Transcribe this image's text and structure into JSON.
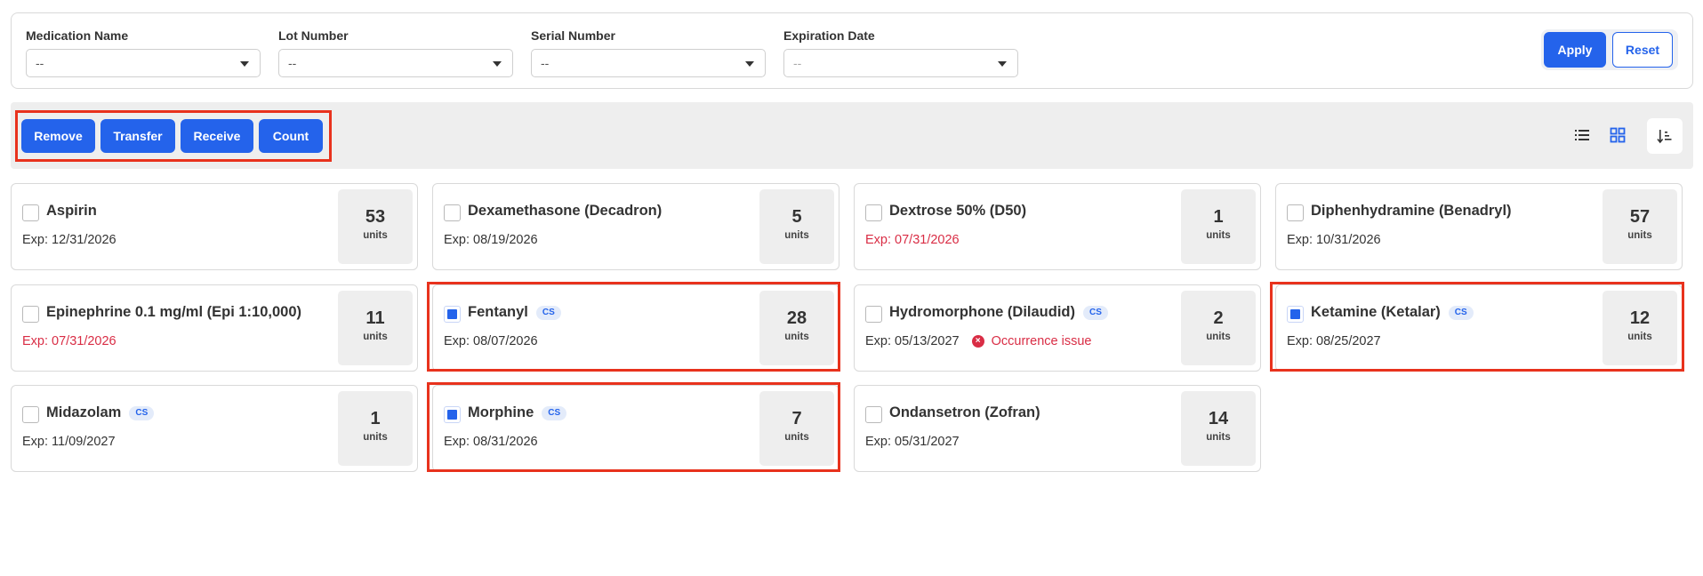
{
  "filters": [
    {
      "label": "Medication Name",
      "value": "--",
      "muted": false
    },
    {
      "label": "Lot Number",
      "value": "--",
      "muted": false
    },
    {
      "label": "Serial Number",
      "value": "--",
      "muted": false
    },
    {
      "label": "Expiration Date",
      "value": "--",
      "muted": true
    }
  ],
  "filter_actions": {
    "apply_label": "Apply",
    "reset_label": "Reset"
  },
  "actions": {
    "remove": "Remove",
    "transfer": "Transfer",
    "receive": "Receive",
    "count": "Count"
  },
  "view_controls": {
    "list_icon": "list-view-icon",
    "grid_icon": "grid-view-icon",
    "sort_icon": "sort-icon",
    "active_view": "grid"
  },
  "colors": {
    "primary": "#2463eb",
    "expired": "#d92d45",
    "highlight": "#e8321d"
  },
  "medications": [
    {
      "name": "Aspirin",
      "cs": false,
      "checked": false,
      "exp": "Exp: 12/31/2026",
      "expired": false,
      "issue": "",
      "qty": "53",
      "unit": "units"
    },
    {
      "name": "Dexamethasone (Decadron)",
      "cs": false,
      "checked": false,
      "exp": "Exp: 08/19/2026",
      "expired": false,
      "issue": "",
      "qty": "5",
      "unit": "units"
    },
    {
      "name": "Dextrose 50% (D50)",
      "cs": false,
      "checked": false,
      "exp": "Exp: 07/31/2026",
      "expired": true,
      "issue": "",
      "qty": "1",
      "unit": "units"
    },
    {
      "name": "Diphenhydramine (Benadryl)",
      "cs": false,
      "checked": false,
      "exp": "Exp: 10/31/2026",
      "expired": false,
      "issue": "",
      "qty": "57",
      "unit": "units"
    },
    {
      "name": "Epinephrine 0.1 mg/ml (Epi 1:10,000)",
      "cs": false,
      "checked": false,
      "exp": "Exp: 07/31/2026",
      "expired": true,
      "issue": "",
      "qty": "11",
      "unit": "units"
    },
    {
      "name": "Fentanyl",
      "cs": true,
      "checked": true,
      "exp": "Exp: 08/07/2026",
      "expired": false,
      "issue": "",
      "qty": "28",
      "unit": "units"
    },
    {
      "name": "Hydromorphone (Dilaudid)",
      "cs": true,
      "checked": false,
      "exp": "Exp: 05/13/2027",
      "expired": false,
      "issue": "Occurrence issue",
      "qty": "2",
      "unit": "units"
    },
    {
      "name": "Ketamine (Ketalar)",
      "cs": true,
      "checked": true,
      "exp": "Exp: 08/25/2027",
      "expired": false,
      "issue": "",
      "qty": "12",
      "unit": "units"
    },
    {
      "name": "Midazolam",
      "cs": true,
      "checked": false,
      "exp": "Exp: 11/09/2027",
      "expired": false,
      "issue": "",
      "qty": "1",
      "unit": "units"
    },
    {
      "name": "Morphine",
      "cs": true,
      "checked": true,
      "exp": "Exp: 08/31/2026",
      "expired": false,
      "issue": "",
      "qty": "7",
      "unit": "units"
    },
    {
      "name": "Ondansetron (Zofran)",
      "cs": false,
      "checked": false,
      "exp": "Exp: 05/31/2027",
      "expired": false,
      "issue": "",
      "qty": "14",
      "unit": "units"
    }
  ],
  "cs_badge_label": "CS"
}
